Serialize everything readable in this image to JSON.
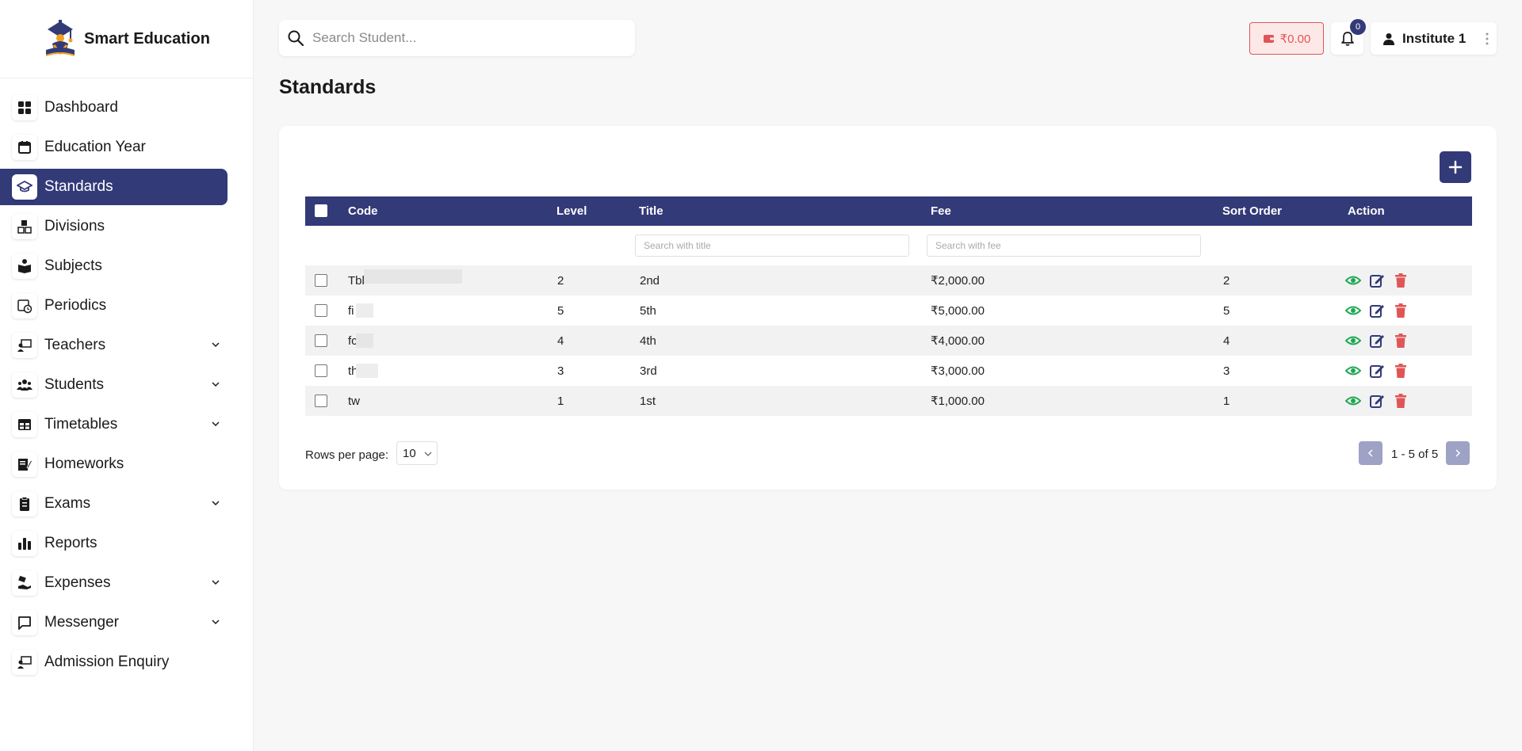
{
  "brand": {
    "name": "Smart Education"
  },
  "sidebar": {
    "items": [
      {
        "label": "Dashboard",
        "icon": "dashboard-icon",
        "expandable": false,
        "active": false
      },
      {
        "label": "Education Year",
        "icon": "calendar-icon",
        "expandable": false,
        "active": false
      },
      {
        "label": "Standards",
        "icon": "graduation-cap-icon",
        "expandable": false,
        "active": true
      },
      {
        "label": "Divisions",
        "icon": "blocks-icon",
        "expandable": false,
        "active": false
      },
      {
        "label": "Subjects",
        "icon": "book-reader-icon",
        "expandable": false,
        "active": false
      },
      {
        "label": "Periodics",
        "icon": "calendar-clock-icon",
        "expandable": false,
        "active": false
      },
      {
        "label": "Teachers",
        "icon": "teacher-board-icon",
        "expandable": true,
        "active": false
      },
      {
        "label": "Students",
        "icon": "users-icon",
        "expandable": true,
        "active": false
      },
      {
        "label": "Timetables",
        "icon": "table-icon",
        "expandable": true,
        "active": false
      },
      {
        "label": "Homeworks",
        "icon": "edit-document-icon",
        "expandable": false,
        "active": false
      },
      {
        "label": "Exams",
        "icon": "clipboard-icon",
        "expandable": true,
        "active": false
      },
      {
        "label": "Reports",
        "icon": "bar-chart-icon",
        "expandable": false,
        "active": false
      },
      {
        "label": "Expenses",
        "icon": "hand-money-icon",
        "expandable": true,
        "active": false
      },
      {
        "label": "Messenger",
        "icon": "message-icon",
        "expandable": true,
        "active": false
      },
      {
        "label": "Admission Enquiry",
        "icon": "teacher-board-icon",
        "expandable": false,
        "active": false
      }
    ]
  },
  "topbar": {
    "search_placeholder": "Search Student...",
    "wallet_amount": "₹0.00",
    "notification_count": "0",
    "user_name": "Institute 1"
  },
  "page": {
    "title": "Standards"
  },
  "table": {
    "headers": {
      "code": "Code",
      "level": "Level",
      "title": "Title",
      "fee": "Fee",
      "sort_order": "Sort Order",
      "action": "Action"
    },
    "filters": {
      "title_placeholder": "Search with title",
      "fee_placeholder": "Search with fee"
    },
    "rows": [
      {
        "code": "Tbl",
        "level": "2",
        "title": "2nd",
        "fee": "₹2,000.00",
        "sort_order": "2"
      },
      {
        "code": "fi",
        "level": "5",
        "title": "5th",
        "fee": "₹5,000.00",
        "sort_order": "5"
      },
      {
        "code": "fc",
        "level": "4",
        "title": "4th",
        "fee": "₹4,000.00",
        "sort_order": "4"
      },
      {
        "code": "th",
        "level": "3",
        "title": "3rd",
        "fee": "₹3,000.00",
        "sort_order": "3"
      },
      {
        "code": "tw",
        "level": "1",
        "title": "1st",
        "fee": "₹1,000.00",
        "sort_order": "1"
      }
    ]
  },
  "pagination": {
    "rows_per_page_label": "Rows per page:",
    "rows_per_page_value": "10",
    "range_text": "1 - 5 of 5"
  },
  "colors": {
    "primary": "#333a78",
    "danger": "#e05555",
    "view": "#1fa855"
  }
}
